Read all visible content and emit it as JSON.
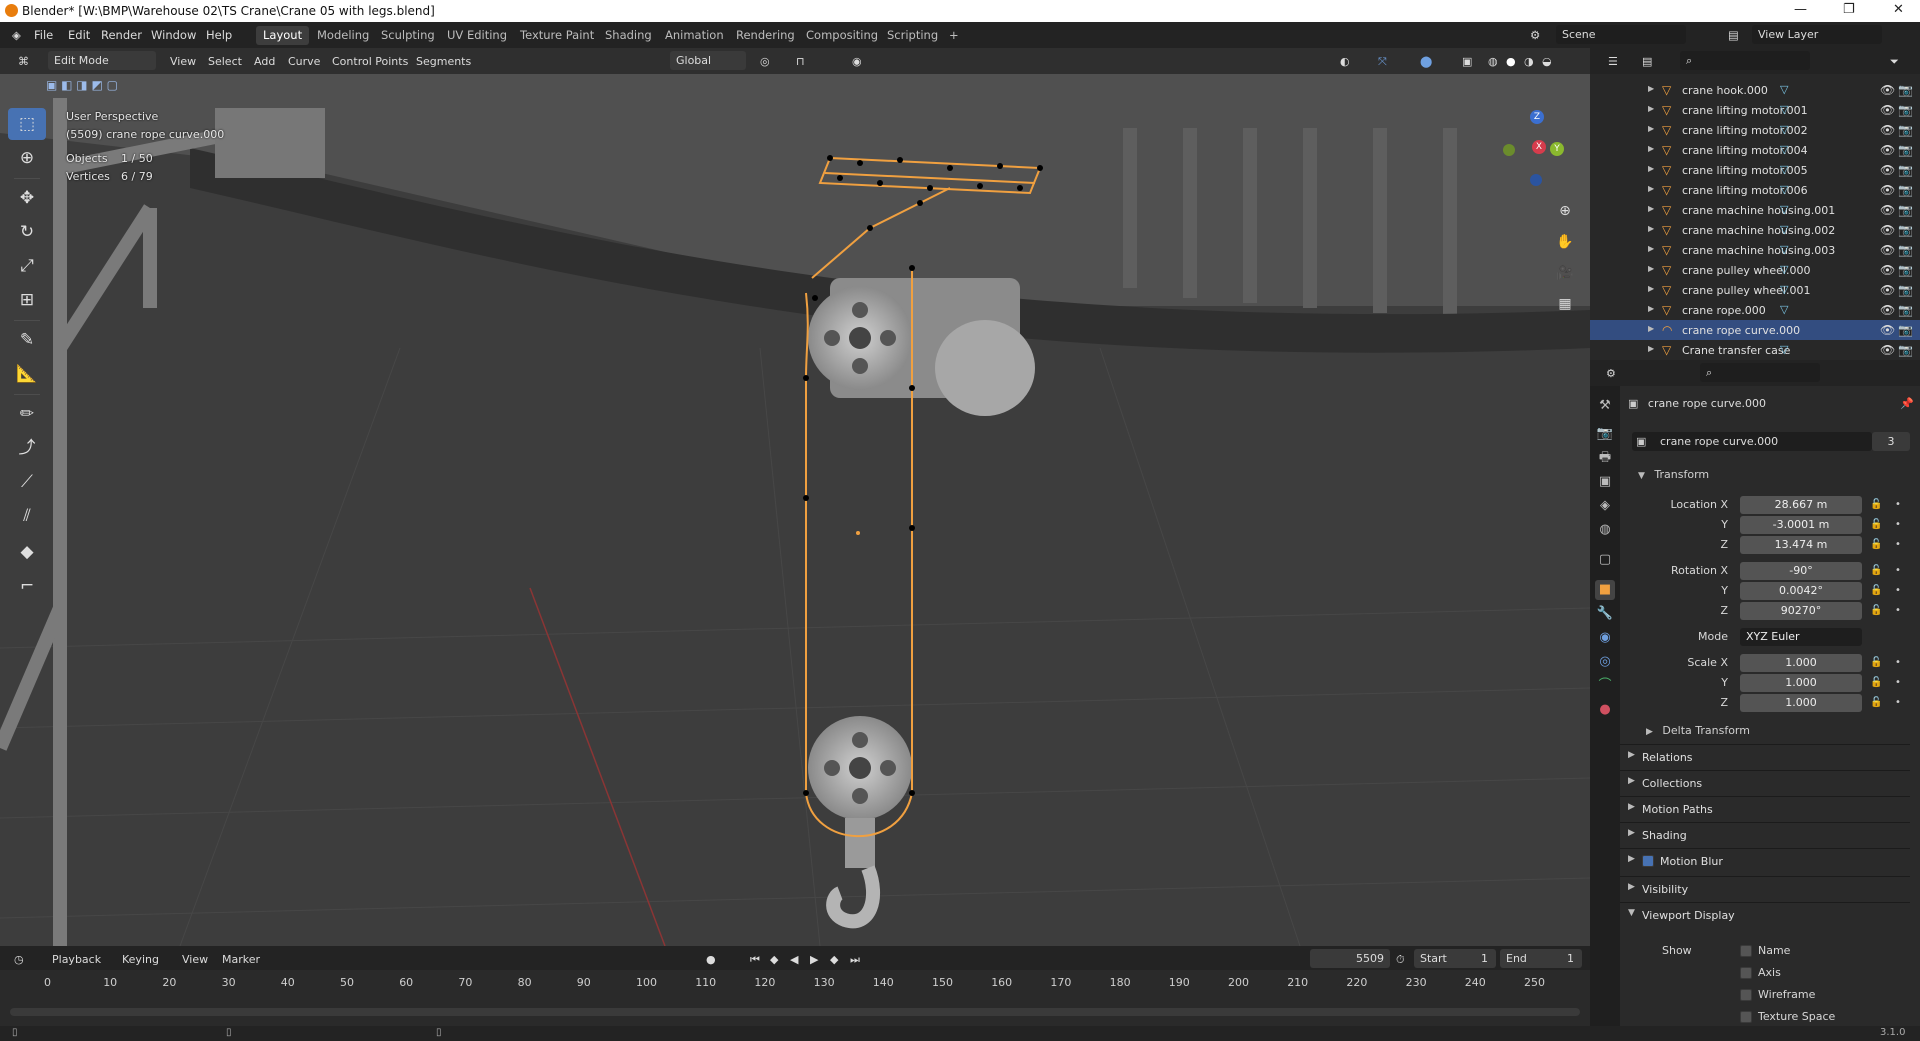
{
  "window": {
    "title": "Blender* [W:\\BMP\\Warehouse 02\\TS Crane\\Crane 05 with legs.blend]"
  },
  "menu": {
    "items": [
      "File",
      "Edit",
      "Render",
      "Window",
      "Help"
    ]
  },
  "workspaces": {
    "tabs": [
      "Layout",
      "Modeling",
      "Sculpting",
      "UV Editing",
      "Texture Paint",
      "Shading",
      "Animation",
      "Rendering",
      "Compositing",
      "Scripting"
    ],
    "active": "Layout",
    "add": "+"
  },
  "scene": {
    "label": "Scene",
    "view_layer": "View Layer"
  },
  "viewport_header": {
    "mode": "Edit Mode",
    "menus": [
      "View",
      "Select",
      "Add",
      "Curve",
      "Control Points",
      "Segments"
    ],
    "orientation": "Global"
  },
  "viewport": {
    "perspective": "User Perspective",
    "object_info": "(5509) crane rope curve.000",
    "objects_label": "Objects",
    "objects_value": "1 / 50",
    "vertices_label": "Vertices",
    "vertices_value": "6 / 79",
    "gizmo": {
      "x": "X",
      "y": "Y",
      "z": "Z"
    }
  },
  "outliner": {
    "rows": [
      {
        "name": "crane hook.000"
      },
      {
        "name": "crane lifting motor.001"
      },
      {
        "name": "crane lifting motor.002"
      },
      {
        "name": "crane lifting motor.004"
      },
      {
        "name": "crane lifting motor.005"
      },
      {
        "name": "crane lifting motor.006"
      },
      {
        "name": "crane machine housing.001"
      },
      {
        "name": "crane machine housing.002"
      },
      {
        "name": "crane machine housing.003"
      },
      {
        "name": "crane pulley wheel.000"
      },
      {
        "name": "crane pulley wheel.001"
      },
      {
        "name": "crane rope.000"
      },
      {
        "name": "crane rope curve.000"
      },
      {
        "name": "Crane transfer case"
      }
    ],
    "selected": "crane rope curve.000"
  },
  "properties": {
    "object_name": "crane rope curve.000",
    "datablock": "crane rope curve.000",
    "users": "3",
    "transform_label": "Transform",
    "location": {
      "label": "Location X",
      "x": "28.667 m",
      "y": "-3.0001 m",
      "z": "13.474 m"
    },
    "rotation": {
      "label": "Rotation X",
      "x": "-90°",
      "y": "0.0042°",
      "z": "90270°"
    },
    "mode": {
      "label": "Mode",
      "value": "XYZ Euler"
    },
    "scale": {
      "label": "Scale X",
      "x": "1.000",
      "y": "1.000",
      "z": "1.000"
    },
    "axis": {
      "y": "Y",
      "z": "Z"
    },
    "sections": [
      "Delta Transform",
      "Relations",
      "Collections",
      "Motion Paths",
      "Shading",
      "Motion Blur",
      "Visibility",
      "Viewport Display"
    ],
    "viewport_display": {
      "show_label": "Show",
      "options": [
        "Name",
        "Axis",
        "Wireframe",
        "Texture Space"
      ]
    }
  },
  "timeline": {
    "menus": [
      "Playback",
      "Keying",
      "View",
      "Marker"
    ],
    "current_frame": "5509",
    "start_label": "Start",
    "start": "1",
    "end_label": "End",
    "end": "1",
    "ticks": [
      "0",
      "10",
      "20",
      "30",
      "40",
      "50",
      "60",
      "70",
      "80",
      "90",
      "100",
      "110",
      "120",
      "130",
      "140",
      "150",
      "160",
      "170",
      "180",
      "190",
      "200",
      "210",
      "220",
      "230",
      "240",
      "250"
    ]
  },
  "status": {
    "version": "3.1.0"
  },
  "colors": {
    "accent": "#4772b3",
    "selection": "#f0a040",
    "viewport_bg": "#3d3d3d"
  }
}
